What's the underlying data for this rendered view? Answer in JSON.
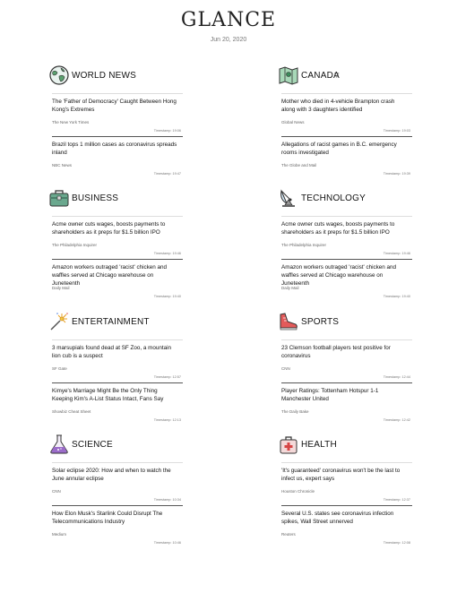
{
  "app": {
    "title": "GLANCE",
    "date": "Jun 20, 2020"
  },
  "sections": [
    {
      "name": "WORLD NEWS",
      "icon": "globe-icon",
      "dropdown": false,
      "items": [
        {
          "headline": "The 'Father of Democracy' Caught Between Hong Kong's Extremes",
          "source": "The New York Times",
          "timestamp": "Timestamp: 19:06"
        },
        {
          "headline": "Brazil tops 1 million cases as coronavirus spreads inland",
          "source": "NBC News",
          "timestamp": "Timestamp: 19:47"
        }
      ]
    },
    {
      "name": "CANADA",
      "icon": "map-icon",
      "dropdown": true,
      "dropdown_glyph": "▽",
      "items": [
        {
          "headline": "Mother who died in 4-vehicle Brampton crash along with 3 daughters identified",
          "source": "Global News",
          "timestamp": "Timestamp: 19:03"
        },
        {
          "headline": "Allegations of racist games in B.C. emergency rooms investigated",
          "source": "The Globe and Mail",
          "timestamp": "Timestamp: 19:39"
        }
      ]
    },
    {
      "name": "BUSINESS",
      "icon": "briefcase-icon",
      "dropdown": false,
      "items": [
        {
          "headline": "Acme owner cuts wages, boosts payments to shareholders as it preps for $1.5 billion IPO",
          "source": "The Philadelphia Inquirer",
          "timestamp": "Timestamp: 19:46"
        },
        {
          "headline": "Amazon workers outraged 'racist' chicken and waffles served at Chicago warehouse on Juneteenth",
          "source": "Daily Mail",
          "timestamp": "Timestamp: 19:40"
        }
      ]
    },
    {
      "name": "TECHNOLOGY",
      "icon": "satellite-dish-icon",
      "dropdown": false,
      "items": [
        {
          "headline": "Acme owner cuts wages, boosts payments to shareholders as it preps for $1.5 billion IPO",
          "source": "The Philadelphia Inquirer",
          "timestamp": "Timestamp: 19:46"
        },
        {
          "headline": "Amazon workers outraged 'racist' chicken and waffles served at Chicago warehouse on Juneteenth",
          "source": "Daily Mail",
          "timestamp": "Timestamp: 19:40"
        }
      ]
    },
    {
      "name": "ENTERTAINMENT",
      "icon": "sparkler-icon",
      "dropdown": false,
      "items": [
        {
          "headline": "3 marsupials found dead at SF Zoo, a mountain lion cub is a suspect",
          "source": "SF Gate",
          "timestamp": "Timestamp: 12:57"
        },
        {
          "headline": "Kimye's Marriage Might Be the Only Thing Keeping Kim's A-List Status Intact, Fans Say",
          "source": "Showbiz Cheat Sheet",
          "timestamp": "Timestamp: 12:13"
        }
      ]
    },
    {
      "name": "SPORTS",
      "icon": "sneaker-icon",
      "dropdown": false,
      "items": [
        {
          "headline": "23 Clemson football players test positive for coronavirus",
          "source": "CNN",
          "timestamp": "Timestamp: 12:44"
        },
        {
          "headline": "Player Ratings: Tottenham Hotspur 1-1 Manchester United",
          "source": "The Daily Bake",
          "timestamp": "Timestamp: 12:42"
        }
      ]
    },
    {
      "name": "SCIENCE",
      "icon": "flask-icon",
      "dropdown": false,
      "items": [
        {
          "headline": "Solar eclipse 2020: How and when to watch the June annular eclipse",
          "source": "CNN",
          "timestamp": "Timestamp: 10:34"
        },
        {
          "headline": "How Elon Musk's Starlink Could Disrupt The Telecommunications Industry",
          "source": "Medium",
          "timestamp": "Timestamp: 10:46"
        }
      ]
    },
    {
      "name": "HEALTH",
      "icon": "medical-bag-icon",
      "dropdown": false,
      "items": [
        {
          "headline": "'It's guaranteed' coronavirus won't be the last to infect us, expert says",
          "source": "Houston Chronicle",
          "timestamp": "Timestamp: 12:37"
        },
        {
          "headline": "Several U.S. states see coronavirus infection spikes, Wall Street unnerved",
          "source": "Reuters",
          "timestamp": "Timestamp: 12:08"
        }
      ]
    }
  ],
  "colors": {
    "text": "#111111",
    "muted": "#777777",
    "divider": "#555555",
    "scroll_thumb": "#999999"
  }
}
